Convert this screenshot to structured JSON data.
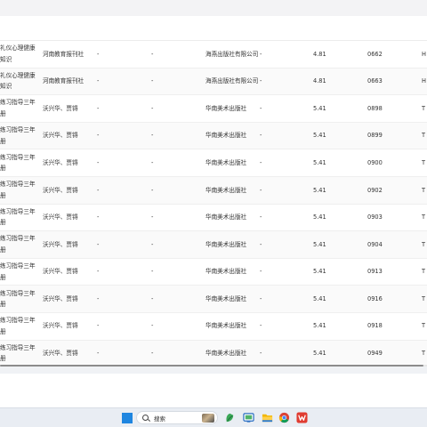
{
  "table": {
    "rows": [
      {
        "title": "礼仪心理健康知识",
        "author": "河南教育报刊社",
        "d1": "-",
        "d2": "-",
        "publisher": "海燕出版社有限公司",
        "d3": "-",
        "price": "4.81",
        "code": "0662",
        "extra": "H"
      },
      {
        "title": "礼仪心理健康知识",
        "author": "河南教育报刊社",
        "d1": "-",
        "d2": "-",
        "publisher": "海燕出版社有限公司",
        "d3": "-",
        "price": "4.81",
        "code": "0663",
        "extra": "H"
      },
      {
        "title": "练习指导三年册",
        "author": "沃兴华、贾锝",
        "d1": "-",
        "d2": "-",
        "publisher": "华南美术出版社",
        "d3": "-",
        "price": "5.41",
        "code": "0898",
        "extra": "T"
      },
      {
        "title": "练习指导三年册",
        "author": "沃兴华、贾锝",
        "d1": "-",
        "d2": "-",
        "publisher": "华南美术出版社",
        "d3": "-",
        "price": "5.41",
        "code": "0899",
        "extra": "T"
      },
      {
        "title": "练习指导三年册",
        "author": "沃兴华、贾锝",
        "d1": "-",
        "d2": "-",
        "publisher": "华南美术出版社",
        "d3": "-",
        "price": "5.41",
        "code": "0900",
        "extra": "T"
      },
      {
        "title": "练习指导三年册",
        "author": "沃兴华、贾锝",
        "d1": "-",
        "d2": "-",
        "publisher": "华南美术出版社",
        "d3": "-",
        "price": "5.41",
        "code": "0902",
        "extra": "T"
      },
      {
        "title": "练习指导三年册",
        "author": "沃兴华、贾锝",
        "d1": "-",
        "d2": "-",
        "publisher": "华南美术出版社",
        "d3": "-",
        "price": "5.41",
        "code": "0903",
        "extra": "T"
      },
      {
        "title": "练习指导三年册",
        "author": "沃兴华、贾锝",
        "d1": "-",
        "d2": "-",
        "publisher": "华南美术出版社",
        "d3": "-",
        "price": "5.41",
        "code": "0904",
        "extra": "T"
      },
      {
        "title": "练习指导三年册",
        "author": "沃兴华、贾锝",
        "d1": "-",
        "d2": "-",
        "publisher": "华南美术出版社",
        "d3": "-",
        "price": "5.41",
        "code": "0913",
        "extra": "T"
      },
      {
        "title": "练习指导三年册",
        "author": "沃兴华、贾锝",
        "d1": "-",
        "d2": "-",
        "publisher": "华南美术出版社",
        "d3": "-",
        "price": "5.41",
        "code": "0916",
        "extra": "T"
      },
      {
        "title": "练习指导三年册",
        "author": "沃兴华、贾锝",
        "d1": "-",
        "d2": "-",
        "publisher": "华南美术出版社",
        "d3": "-",
        "price": "5.41",
        "code": "0918",
        "extra": "T"
      },
      {
        "title": "练习指导三年册",
        "author": "沃兴华、贾锝",
        "d1": "-",
        "d2": "-",
        "publisher": "华南美术出版社",
        "d3": "-",
        "price": "5.41",
        "code": "0949",
        "extra": "T"
      }
    ]
  },
  "taskbar": {
    "search_label": "搜索",
    "icons": [
      "windows-start-icon",
      "widgets-icon",
      "chat-icon",
      "file-explorer-icon",
      "edge-icon",
      "chrome-icon",
      "wps-icon"
    ]
  },
  "colors": {
    "start_blue": "#1f86e0",
    "table_bg": "#ffffff",
    "page_bg": "#f0f2f5",
    "text": "#333333",
    "wps_red": "#e03c31"
  }
}
